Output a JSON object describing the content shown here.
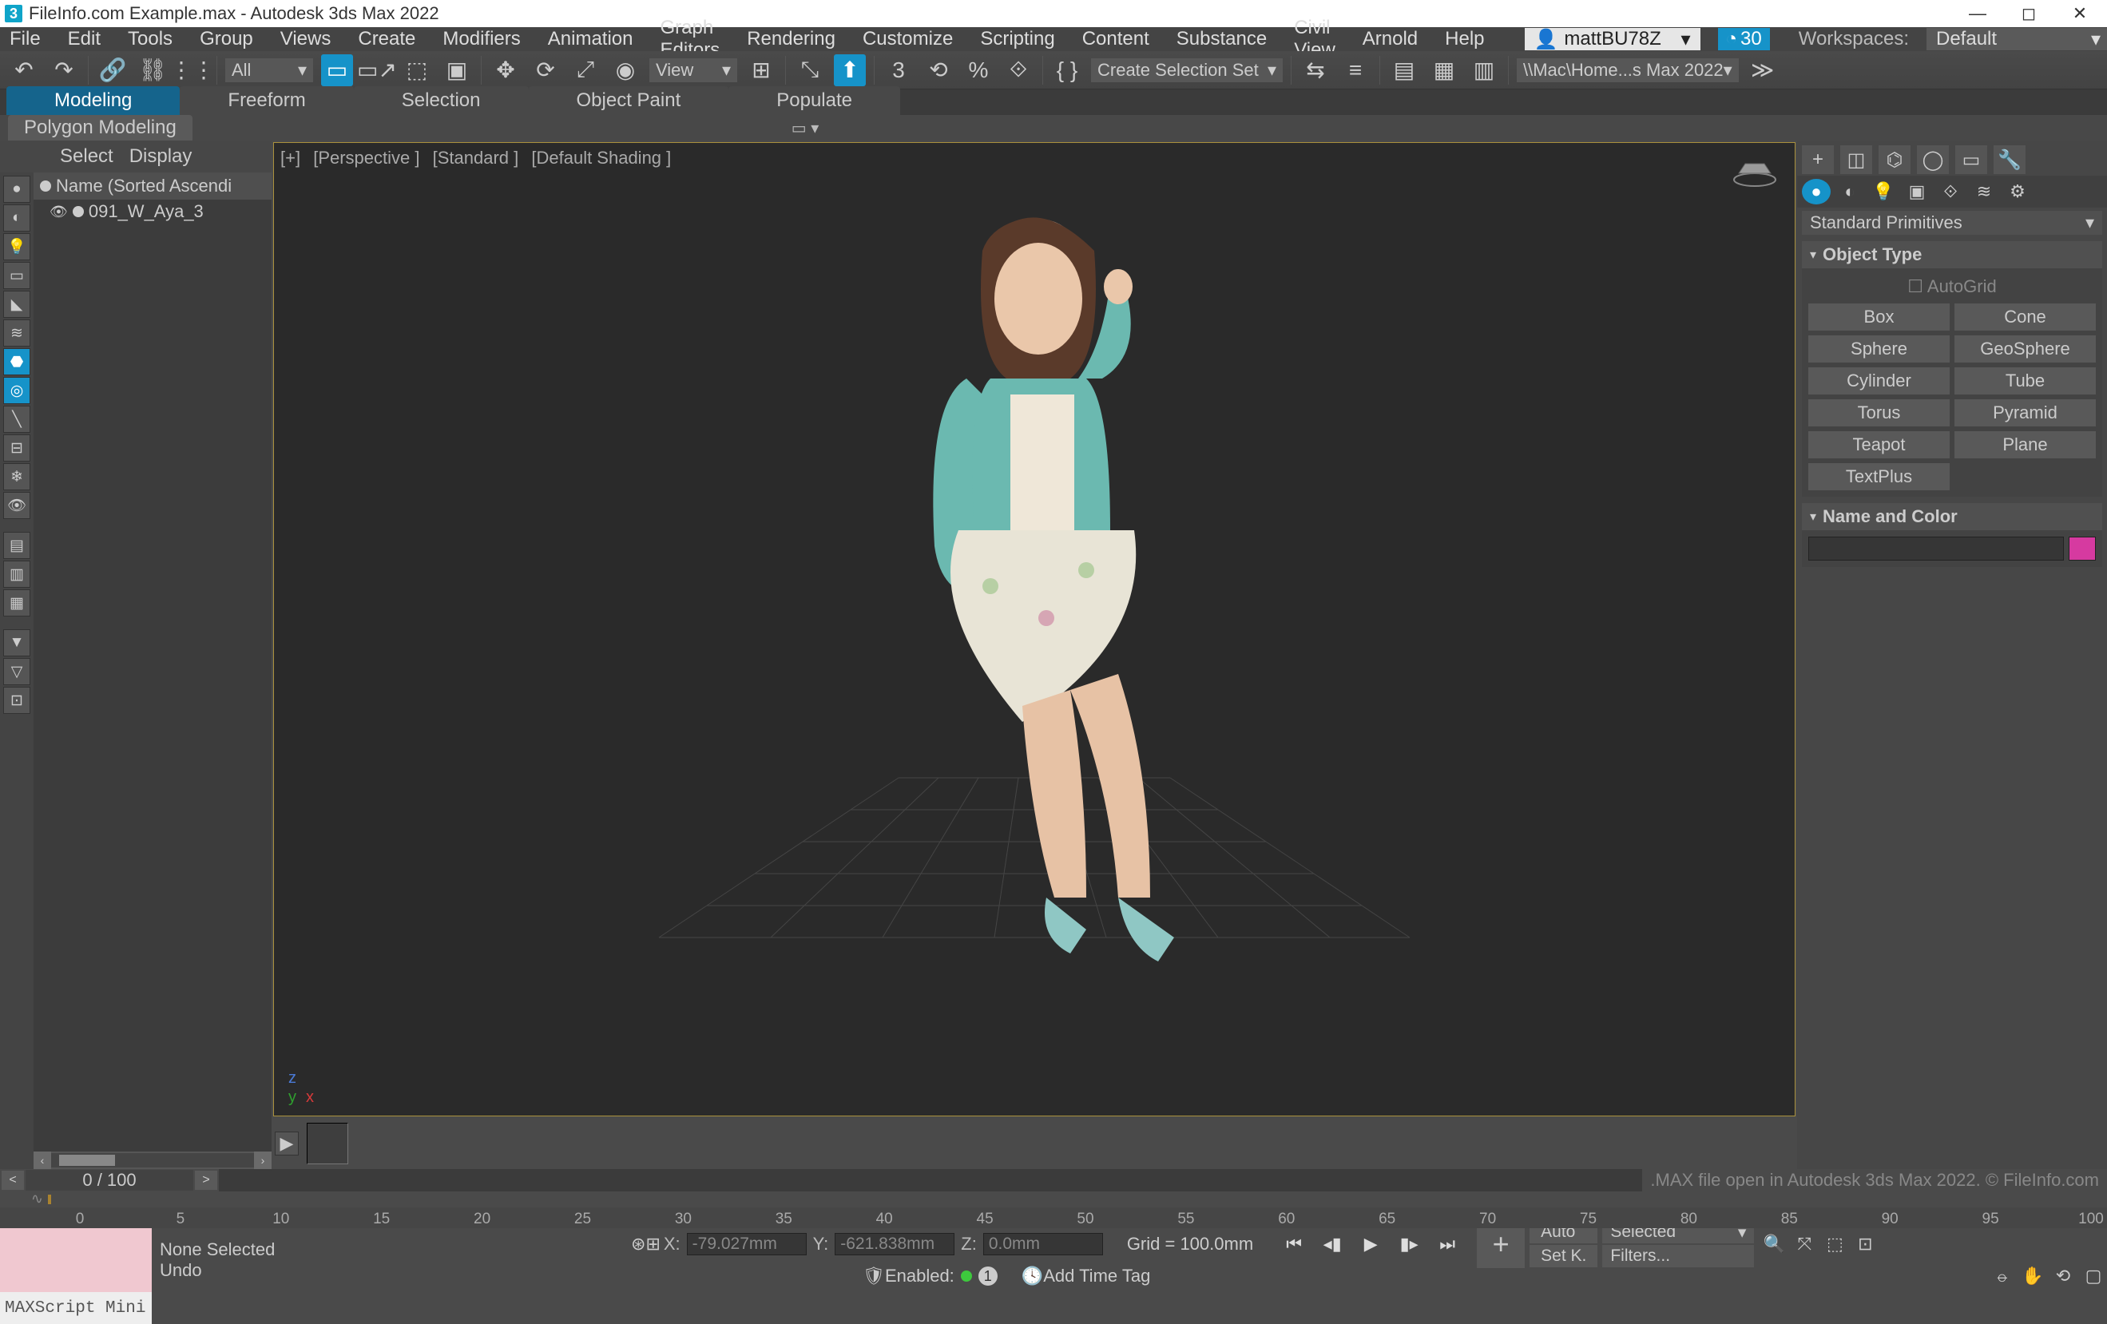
{
  "title_bar": {
    "title": "FileInfo.com Example.max - Autodesk 3ds Max 2022",
    "app_icon_text": "3"
  },
  "menu": {
    "items": [
      "File",
      "Edit",
      "Tools",
      "Group",
      "Views",
      "Create",
      "Modifiers",
      "Animation",
      "Graph Editors",
      "Rendering",
      "Customize",
      "Scripting",
      "Content",
      "Substance",
      "Civil View",
      "Arnold",
      "Help"
    ],
    "user": "mattBU78Z",
    "fps": "30",
    "workspaces_label": "Workspaces:",
    "workspace": "Default"
  },
  "main_toolbar": {
    "all_drop": "All",
    "view_drop": "View",
    "create_set_drop": "Create Selection Set",
    "path_drop": "\\\\Mac\\Home...s Max 2022"
  },
  "tabs": {
    "row1": [
      "Modeling",
      "Freeform",
      "Selection",
      "Object Paint",
      "Populate"
    ],
    "active1": 0,
    "row2": "Polygon Modeling"
  },
  "left": {
    "head": [
      "Select",
      "Display"
    ],
    "tree_head": "Name (Sorted Ascendi",
    "tree_items": [
      {
        "label": "091_W_Aya_3"
      }
    ]
  },
  "viewport": {
    "head_items": [
      "[+]",
      "[Perspective ]",
      "[Standard ]",
      "[Default Shading ]"
    ],
    "axis_x": "x",
    "axis_y": "y",
    "axis_z": "z",
    "watermark": ".MAX file open in Autodesk 3ds Max 2022. © FileInfo.com"
  },
  "right": {
    "dropdown": "Standard Primitives",
    "section_objtype": "Object Type",
    "autogrid": "AutoGrid",
    "primitives": [
      "Box",
      "Cone",
      "Sphere",
      "GeoSphere",
      "Cylinder",
      "Tube",
      "Torus",
      "Pyramid",
      "Teapot",
      "Plane",
      "TextPlus"
    ],
    "section_namecolor": "Name and Color",
    "color": "#d63aa0"
  },
  "timeline": {
    "pos": "0 / 100",
    "ticks": [
      "0",
      "5",
      "10",
      "15",
      "20",
      "25",
      "30",
      "35",
      "40",
      "45",
      "50",
      "55",
      "60",
      "65",
      "70",
      "75",
      "80",
      "85",
      "90",
      "95",
      "100"
    ]
  },
  "status": {
    "selection": "None Selected",
    "undo": "Undo",
    "script_label": "MAXScript Mini",
    "x": "-79.027mm",
    "y": "-621.838mm",
    "z": "0.0mm",
    "xl": "X:",
    "yl": "Y:",
    "zl": "Z:",
    "grid": "Grid = 100.0mm",
    "auto": "Auto",
    "setk": "Set K.",
    "selected": "Selected",
    "filters": "Filters...",
    "enabled_label": "Enabled:",
    "enabled_num": "1",
    "add_time_tag": "Add Time Tag"
  }
}
